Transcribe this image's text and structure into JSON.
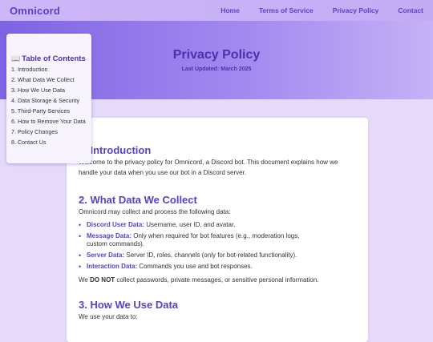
{
  "nav": {
    "brand": "Omnicord",
    "links": [
      "Home",
      "Terms of Service",
      "Privacy Policy",
      "Contact"
    ]
  },
  "hero": {
    "title": "Privacy Policy",
    "updated": "Last Updated: March 2025"
  },
  "toc": {
    "icon": "book-icon",
    "title": "Table of Contents",
    "items": [
      "1. Introduction",
      "2. What Data We Collect",
      "3. How We Use Data",
      "4. Data Storage & Security",
      "5. Third-Party Services",
      "6. How to Remove Your Data",
      "7. Policy Changes",
      "8. Contact Us"
    ]
  },
  "content": {
    "intro": {
      "heading": "1. Introduction",
      "text": "Welcome to the privacy policy for Omnicord, a Discord bot. This document explains how we handle your data when you use our bot in a Discord server."
    },
    "collect": {
      "heading": "2. What Data We Collect",
      "lead": "Omnicord may collect and process the following data:",
      "items": [
        {
          "label": "Discord User Data:",
          "text": " Username, user ID, and avatar."
        },
        {
          "label": "Message Data:",
          "text": " Only when required for bot features (e.g., moderation logs, custom commands)."
        },
        {
          "label": "Server Data:",
          "text": " Server ID, roles, channels (only for bot-related functionality)."
        },
        {
          "label": "Interaction Data:",
          "text": " Commands you use and bot responses."
        }
      ],
      "note_pre": "We ",
      "note_bold": "DO NOT",
      "note_post": " collect passwords, private messages, or sensitive personal information."
    },
    "use": {
      "heading": "3. How We Use Data",
      "lead": "We use your data to:"
    }
  },
  "colors": {
    "accent": "#5b3fc4",
    "page_bg": "#e6dafb",
    "hero_start": "#7e63e3",
    "hero_end": "#c5b2f6"
  }
}
